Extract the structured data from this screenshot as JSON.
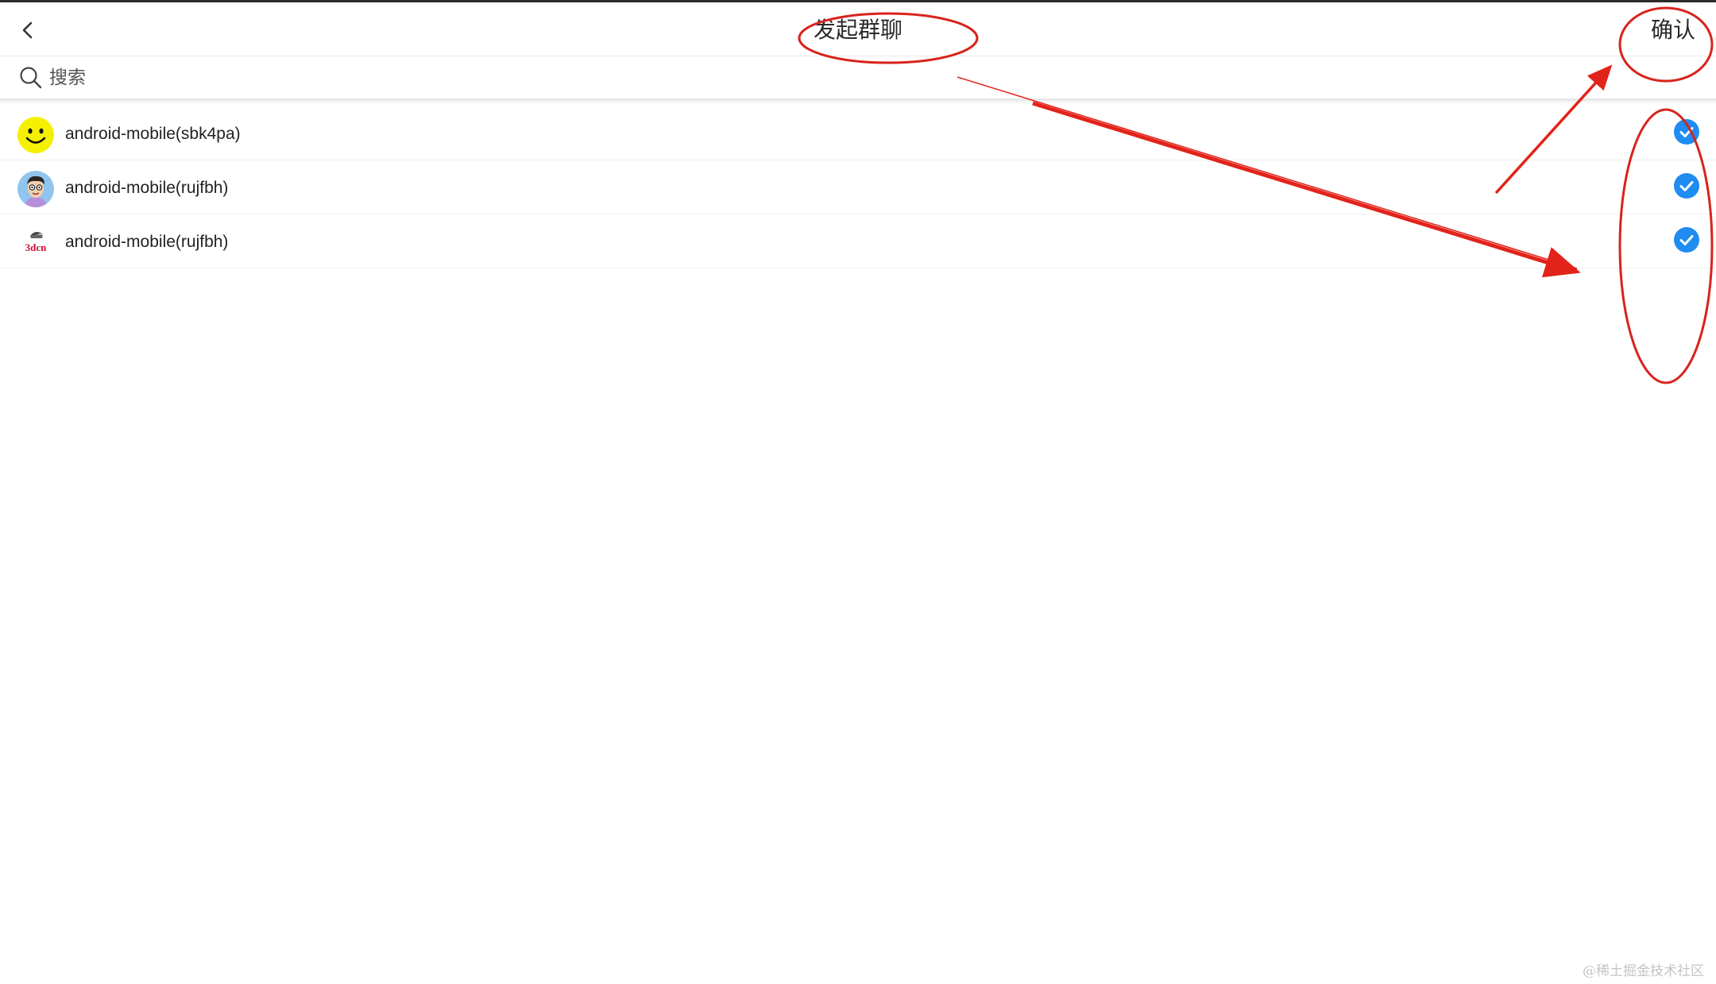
{
  "header": {
    "back_icon": "chevron-left-icon",
    "title": "发起群聊",
    "confirm_label": "确认"
  },
  "search": {
    "icon": "search-icon",
    "placeholder": "搜索"
  },
  "contacts": [
    {
      "name": "android-mobile(sbk4pa)",
      "avatar": "smiley-face-avatar",
      "checked": true
    },
    {
      "name": "android-mobile(rujfbh)",
      "avatar": "cartoon-man-avatar",
      "checked": true
    },
    {
      "name": "android-mobile(rujfbh)",
      "avatar": "3dcn-logo-avatar",
      "avatar_text": "3dcn",
      "checked": true
    }
  ],
  "colors": {
    "accent": "#1e8cf0",
    "annotation": "#e2231a"
  },
  "watermark": "@稀土掘金技术社区"
}
